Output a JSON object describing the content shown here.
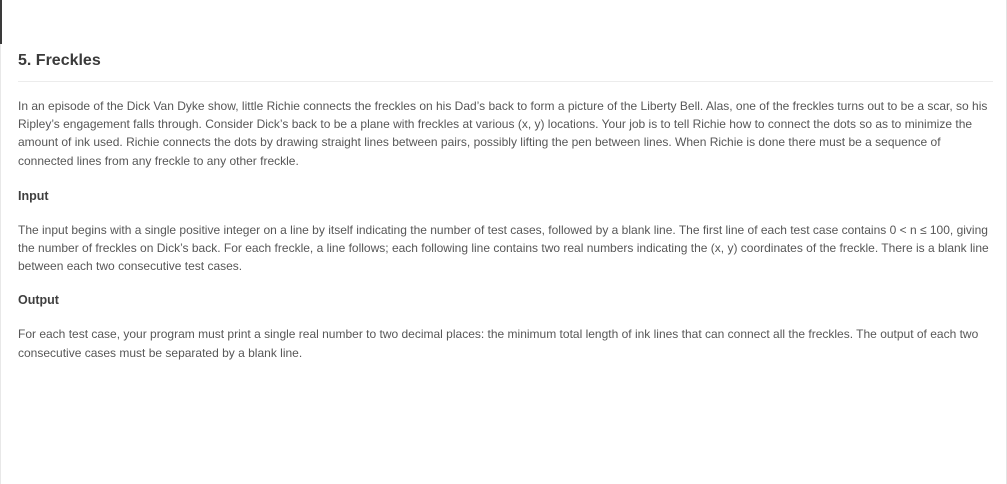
{
  "problem": {
    "title": "5. Freckles",
    "statement": "In an episode of the Dick Van Dyke show, little Richie connects the freckles on his Dad’s back to form a picture of the Liberty Bell. Alas, one of the freckles turns out to be a scar, so his Ripley’s engagement falls through. Consider Dick’s back to be a plane with freckles at various (x, y) locations. Your job is to tell Richie how to connect the dots so as to minimize the amount of ink used. Richie connects the dots by drawing straight lines between pairs, possibly lifting the pen between lines. When Richie is done there must be a sequence of connected lines from any freckle to any other freckle.",
    "input_heading": "Input",
    "input_text": "The input begins with a single positive integer on a line by itself indicating the number of test cases, followed by a blank line. The first line of each test case contains 0 < n ≤ 100, giving the number of freckles on Dick’s back. For each freckle, a line follows; each following line contains two real numbers indicating the (x, y) coordinates of the freckle. There is a blank line between each two consecutive test cases.",
    "output_heading": "Output",
    "output_text": "For each test case, your program must print a single real number to two decimal places: the minimum total length of ink lines that can connect all the freckles. The output of each two consecutive cases must be separated by a blank line."
  }
}
